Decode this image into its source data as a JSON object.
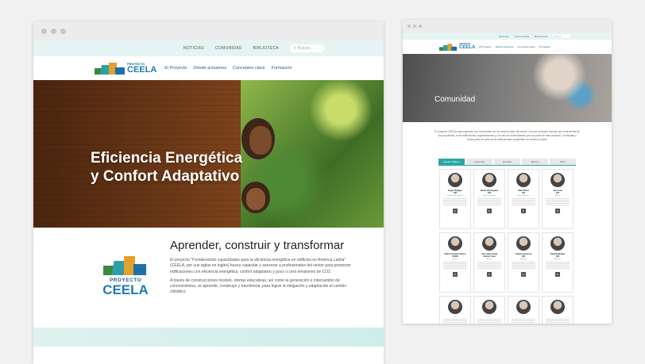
{
  "left": {
    "util_links": [
      "NOTICIAS",
      "COMUNIDAD",
      "BIBLIOTECA"
    ],
    "search_placeholder": "Buscar...",
    "logo": {
      "small": "PROYECTO",
      "big": "CEELA"
    },
    "nav": [
      "El Proyecto",
      "Dónde actuamos",
      "Conceptos clave",
      "Formación"
    ],
    "hero_title": "Eficiencia Energética y Confort Adaptativo",
    "intro": {
      "title": "Aprender, construir y transformar",
      "p1": "El proyecto \"Fortaleciendo capacidades para la eficiencia energética en edificios en América Latina\" (CEELA, por sus siglas en inglés) busca capacitar y asesorar a profesionales del sector para promover edificaciones con eficiencia energética, confort adaptativo y poco o cero emisiones de CO2.",
      "p2": "A través de construcciones modelo, ofertas educativas, así como la generación e intercambio de conocimientos, se aprende, construye y transforma, para lograr la mitigación y adaptación al cambio climático."
    },
    "big_logo": {
      "small": "PROYECTO",
      "big": "CEELA"
    }
  },
  "right": {
    "util_links": [
      "Noticias",
      "Comunidad",
      "Biblioteca"
    ],
    "search_placeholder": "Buscar",
    "logo": {
      "small": "PROYECTO",
      "big": "CEELA"
    },
    "nav": [
      "El Proyecto",
      "Dónde actuamos",
      "Conceptos clave",
      "Formación"
    ],
    "hero_title": "Comunidad",
    "description": "El proyecto CEELA busca generar una comunidad con los actores clave del sector. Conoce al equipo humano que está detrás de las propuestas, a las instituciones, organizaciones y a la red de universidades que son parte de este proyecto. Contáctalo y forma parte de esta red de edificaciones sostenibles en América Latina.",
    "tabs": [
      "Equipo CEELA",
      "Colombia",
      "Ecuador",
      "México",
      "Perú"
    ],
    "active_tab": 0,
    "cards": [
      {
        "name": "Roger Rüdiger",
        "org": "GIZ",
        "role": "Director del proyecto"
      },
      {
        "name": "Nicole Bierregaard",
        "org": "GIZ",
        "role": "Asesora técnica"
      },
      {
        "name": "Pablo Barrs",
        "org": "GIZ",
        "role": "Asesor técnico"
      },
      {
        "name": "Jan Lhota",
        "org": "GIZ",
        "role": "Asesor"
      },
      {
        "name": "Pablo Cornelius Romo",
        "org": "CCMA",
        "role": "Asesor"
      },
      {
        "name": "José Jean Cerdá",
        "org": "Carbon Trust",
        "role": "Asesor"
      },
      {
        "name": "Celeste Espinosa",
        "org": "GIZ",
        "role": "Asesora"
      },
      {
        "name": "Daniela Medina",
        "org": "GIZ",
        "role": "Asesora"
      },
      {
        "name": "",
        "org": "",
        "role": ""
      },
      {
        "name": "",
        "org": "",
        "role": ""
      },
      {
        "name": "",
        "org": "",
        "role": ""
      },
      {
        "name": "",
        "org": "",
        "role": ""
      }
    ],
    "linkedin_label": "in"
  }
}
